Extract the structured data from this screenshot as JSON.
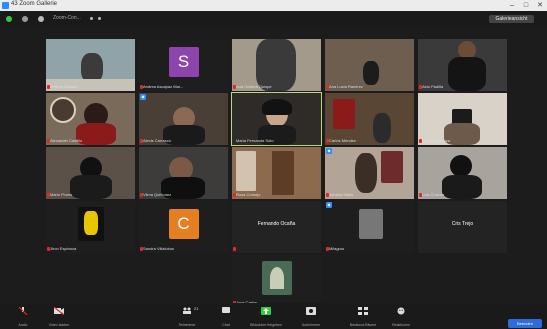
{
  "window": {
    "title": "43 Zoom Gallerie",
    "controls": [
      "–",
      "□",
      "✕"
    ]
  },
  "topbar": {
    "meeting_text": "Zoom-Con...",
    "view_label": "Galerieansicht",
    "dot_colors": [
      "#2ecc40",
      "#9a9a9a",
      "#bbbbbb"
    ]
  },
  "participants": [
    {
      "name": "Andrea Quispe",
      "muted": true
    },
    {
      "name": "Andrea Ascapaz Mar...",
      "avatar_letter": "S",
      "avatar_color": "#8e44ad",
      "muted": true
    },
    {
      "name": "Ana Cristina Quispe",
      "muted": true
    },
    {
      "name": "Ana Lucia Ramirez",
      "muted": true
    },
    {
      "name": "Aldo Padilla",
      "muted": true
    },
    {
      "name": "Alexander Castillo",
      "muted": true
    },
    {
      "name": "Alexis Carrasco",
      "muted": true
    },
    {
      "name": "Maria Fernanda Soto",
      "muted": false,
      "active": true
    },
    {
      "name": "Carlos Mendez",
      "muted": true
    },
    {
      "name": "Diana Espinoza",
      "muted": true
    },
    {
      "name": "Mario Flores",
      "muted": true
    },
    {
      "name": "Vilma Quiñonez",
      "muted": true
    },
    {
      "name": "Rosa Cornejo",
      "muted": true
    },
    {
      "name": "Johana Salas",
      "muted": true
    },
    {
      "name": "Luis Chacon",
      "muted": true
    },
    {
      "name": "Jhon Espinoza",
      "muted": true
    },
    {
      "name": "Sandra Villalobos",
      "avatar_letter": "C",
      "avatar_color": "#e67e22",
      "muted": true
    },
    {
      "name": "Fernando Ocaña",
      "muted": true,
      "label": "Fernando Ocaña"
    },
    {
      "name": "Milagros",
      "muted": true
    },
    {
      "name": "Cris Trejo",
      "muted": false,
      "label": "Cris Trejo"
    },
    {
      "name": "Jose Carlos",
      "muted": true
    }
  ],
  "toolbar": {
    "items": [
      {
        "label": "Audio",
        "icon": "microphone-icon"
      },
      {
        "label": "Video starten",
        "icon": "video-icon"
      },
      {
        "label": "Teilnehmer",
        "icon": "participants-icon",
        "count": "21"
      },
      {
        "label": "Chat",
        "icon": "chat-icon"
      },
      {
        "label": "Bildschirm freigeben",
        "icon": "share-screen-icon"
      },
      {
        "label": "Aufnehmen",
        "icon": "record-icon"
      },
      {
        "label": "Breakout-Räume",
        "icon": "breakout-icon"
      },
      {
        "label": "Reaktionen",
        "icon": "reaction-icon"
      }
    ],
    "end_label": "Beenden"
  }
}
